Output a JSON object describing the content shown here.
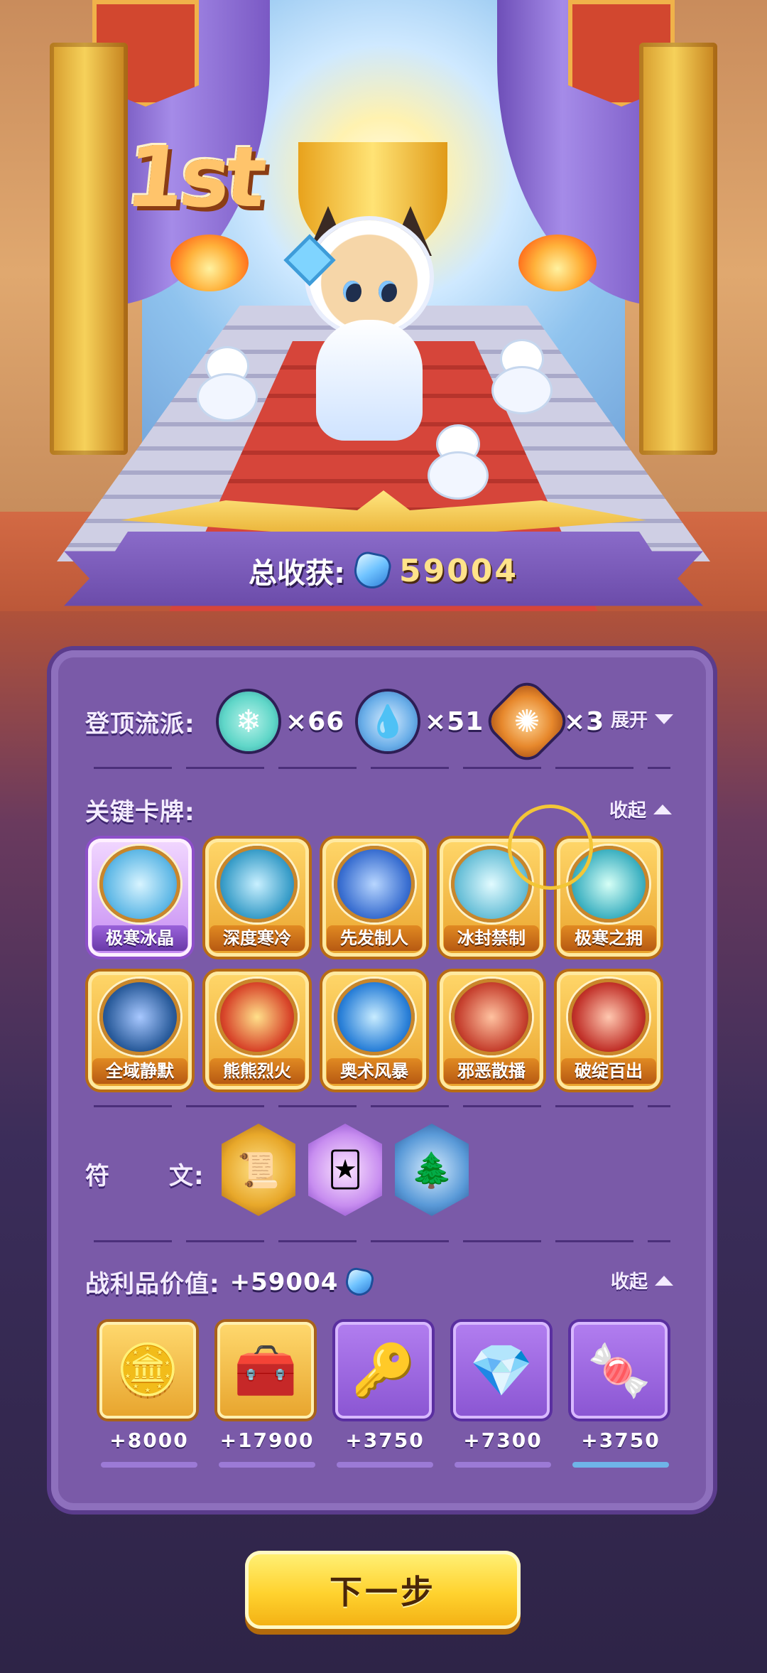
{
  "result": {
    "rank": "1st",
    "total_label": "总收获:",
    "total_value": "59004"
  },
  "schools": {
    "label": "登顶流派:",
    "toggle": "展开",
    "items": [
      {
        "icon": "snowflake-icon",
        "count": "×66",
        "color": "#5fd6c8"
      },
      {
        "icon": "water-drop-icon",
        "count": "×51",
        "color": "#6aaee8"
      },
      {
        "icon": "fire-swirl-icon",
        "count": "×3",
        "color": "#e7882c"
      }
    ]
  },
  "cards": {
    "label": "关键卡牌:",
    "toggle": "收起",
    "items": [
      {
        "name": "极寒冰晶",
        "rarity": "rare",
        "art": "#5fb8e6"
      },
      {
        "name": "深度寒冷",
        "rarity": "gold",
        "art": "#3a9ec9"
      },
      {
        "name": "先发制人",
        "rarity": "gold",
        "art": "#3a6fd1"
      },
      {
        "name": "冰封禁制",
        "rarity": "gold",
        "art": "#6ac0d8"
      },
      {
        "name": "极寒之拥",
        "rarity": "gold",
        "art": "#3fb2c2"
      },
      {
        "name": "全域静默",
        "rarity": "gold",
        "art": "#2a5c9c"
      },
      {
        "name": "熊熊烈火",
        "rarity": "gold",
        "art": "#d8452a"
      },
      {
        "name": "奥术风暴",
        "rarity": "gold",
        "art": "#2a80d8"
      },
      {
        "name": "邪恶散播",
        "rarity": "gold",
        "art": "#c6402e"
      },
      {
        "name": "破绽百出",
        "rarity": "gold",
        "art": "#c2322a"
      }
    ]
  },
  "runes": {
    "label_a": "符",
    "label_b": "文:",
    "items": [
      {
        "icon": "scroll-rune-icon",
        "color": "#e8a82a"
      },
      {
        "icon": "snow-card-rune-icon",
        "color": "#c88ef0"
      },
      {
        "icon": "frost-tree-rune-icon",
        "color": "#5a9ad8"
      }
    ]
  },
  "loot": {
    "label": "战利品价值:",
    "value": "+59004",
    "toggle": "收起",
    "items": [
      {
        "icon": "clover-coin-icon",
        "value": "+8000",
        "style": "gold"
      },
      {
        "icon": "treasure-case-icon",
        "value": "+17900",
        "style": "gold"
      },
      {
        "icon": "silver-key-icon",
        "value": "+3750",
        "style": "purple"
      },
      {
        "icon": "blue-gem-icon",
        "value": "+7300",
        "style": "purple"
      },
      {
        "icon": "cat-candy-icon",
        "value": "+3750",
        "style": "purple"
      }
    ]
  },
  "next_button": "下一步"
}
